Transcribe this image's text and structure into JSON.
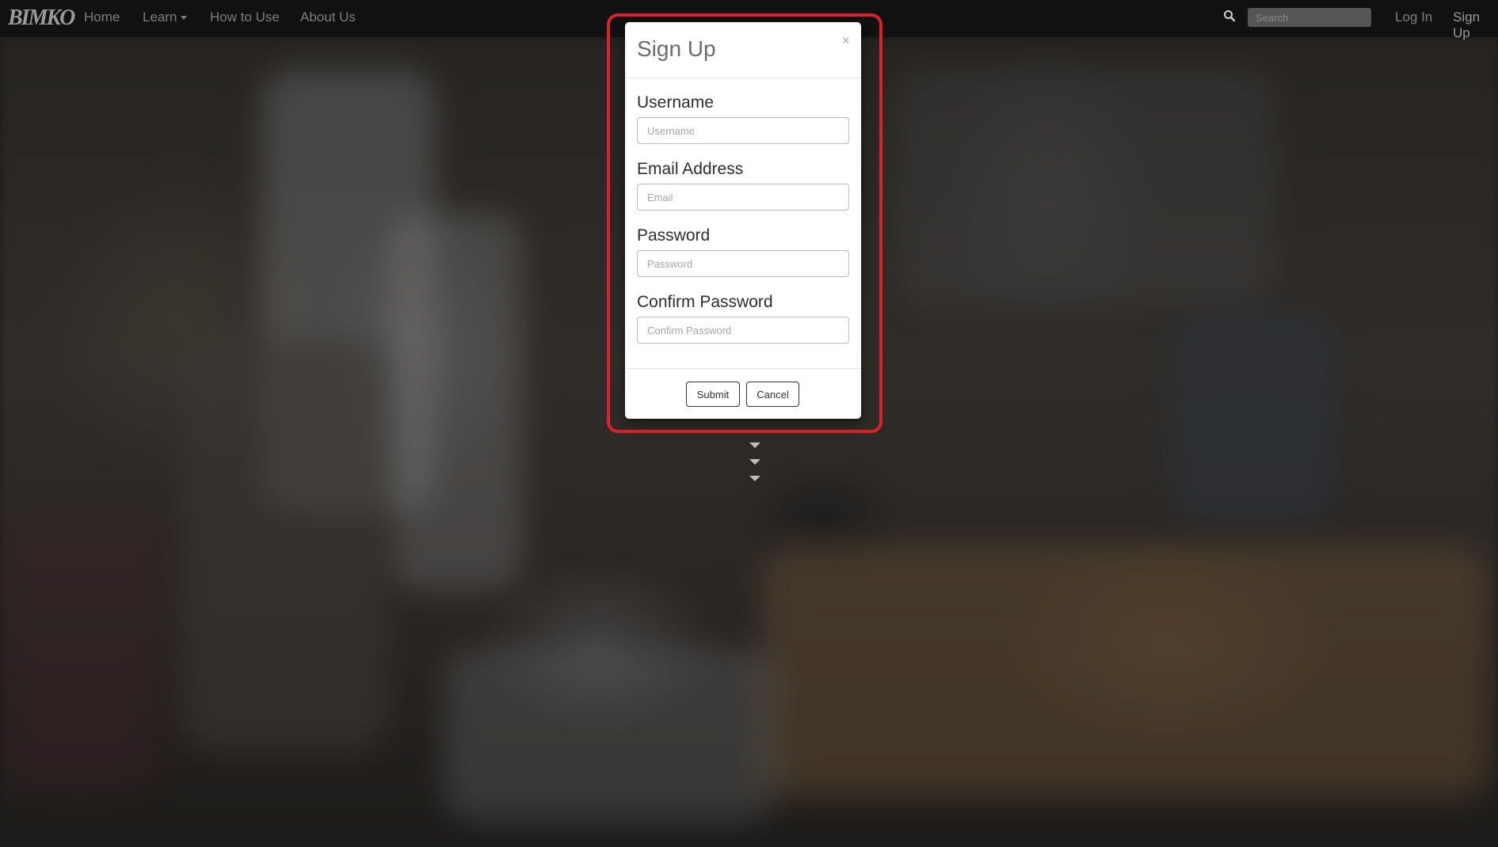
{
  "navbar": {
    "logo_text": "BIMKO",
    "links": [
      "Home",
      "Learn",
      "How to Use",
      "About Us"
    ],
    "search_placeholder": "Search",
    "login_label": "Log In",
    "signup_label": "Sign Up"
  },
  "modal": {
    "title": "Sign Up",
    "close_symbol": "×",
    "fields": [
      {
        "label": "Username",
        "placeholder": "Username"
      },
      {
        "label": "Email Address",
        "placeholder": "Email"
      },
      {
        "label": "Password",
        "placeholder": "Password"
      },
      {
        "label": "Confirm Password",
        "placeholder": "Confirm Password"
      }
    ],
    "submit_label": "Submit",
    "cancel_label": "Cancel"
  },
  "colors": {
    "navbar_bg": "#111111",
    "highlight": "#e0202a"
  },
  "icons": {
    "search": "search-icon",
    "close": "close-icon",
    "scroll_down": "chevron-down-icon"
  }
}
